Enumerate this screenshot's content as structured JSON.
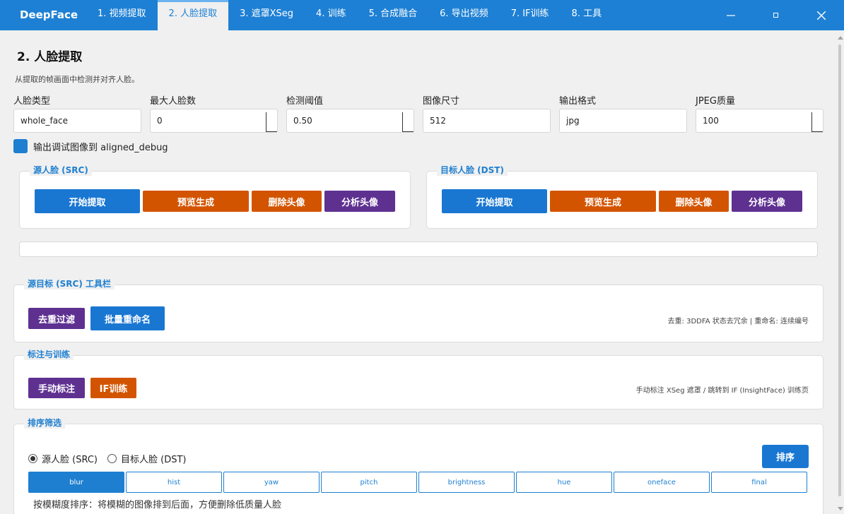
{
  "app": {
    "name": "DeepFace"
  },
  "tabs": [
    {
      "label": "1. 视频提取"
    },
    {
      "label": "2. 人脸提取"
    },
    {
      "label": "3. 遮罩XSeg"
    },
    {
      "label": "4. 训练"
    },
    {
      "label": "5. 合成融合"
    },
    {
      "label": "6. 导出视频"
    },
    {
      "label": "7. IF训练"
    },
    {
      "label": "8. 工具"
    }
  ],
  "page": {
    "title": "2. 人脸提取",
    "description": "从提取的帧画面中检测并对齐人脸。"
  },
  "fields": [
    {
      "label": "人脸类型",
      "value": "whole_face"
    },
    {
      "label": "最大人脸数",
      "value": "0"
    },
    {
      "label": "检测阈值",
      "value": "0.50"
    },
    {
      "label": "图像尺寸",
      "value": "512"
    },
    {
      "label": "输出格式",
      "value": "jpg"
    },
    {
      "label": "JPEG质量",
      "value": "100"
    }
  ],
  "debug_checkbox": {
    "label": "输出调试图像到 aligned_debug",
    "checked": true
  },
  "src_group": {
    "title": "源人脸 (SRC)",
    "buttons": [
      "开始提取",
      "预览生成",
      "删除头像",
      "分析头像"
    ]
  },
  "dst_group": {
    "title": "目标人脸 (DST)",
    "buttons": [
      "开始提取",
      "预览生成",
      "删除头像",
      "分析头像"
    ]
  },
  "toolbar_group": {
    "title": "源目标 (SRC) 工具栏",
    "buttons": [
      "去重过滤",
      "批量重命名"
    ],
    "note": "去重: 3DDFA 状态去冗余 | 重命名: 连续编号"
  },
  "label_group": {
    "title": "标注与训练",
    "buttons": [
      "手动标注",
      "IF训练"
    ],
    "note": "手动标注 XSeg 遮罩 / 跳转到 IF (InsightFace) 训练页"
  },
  "sort_group": {
    "title": "排序筛选",
    "radio": [
      "源人脸 (SRC)",
      "目标人脸 (DST)"
    ],
    "sort_button": "排序",
    "methods": [
      "blur",
      "hist",
      "yaw",
      "pitch",
      "brightness",
      "hue",
      "oneface",
      "final"
    ],
    "description": "按模糊度排序：将模糊的图像排到后面，方便删除低质量人脸"
  },
  "colors": {
    "accent": "#1e80d4",
    "blue_button": "#1977d2",
    "orange_button": "#d35400",
    "purple_button": "#5e3191"
  }
}
